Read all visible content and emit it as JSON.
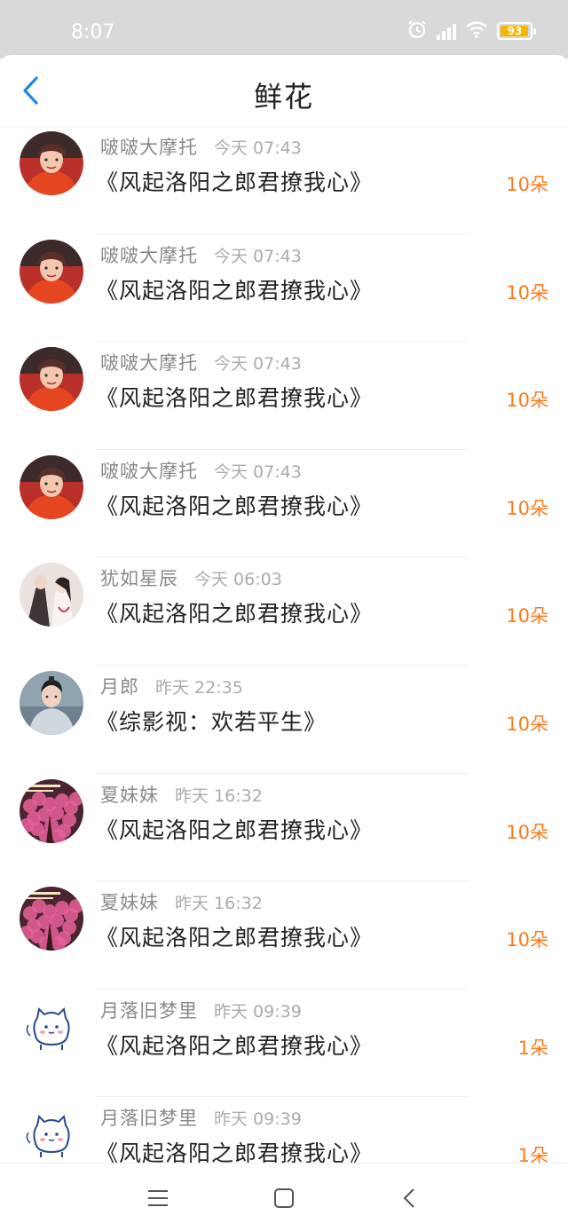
{
  "status_bar": {
    "time": "8:07",
    "battery": "93",
    "battery_color": "#f5b400"
  },
  "header": {
    "title": "鲜花",
    "accent": "#1e88e5"
  },
  "gifts": [
    {
      "avatar": "avatar-boy-orange-hoodie",
      "user": "啵啵大摩托",
      "time": "今天 07:43",
      "book": "《风起洛阳之郎君撩我心》",
      "count": "10朵"
    },
    {
      "avatar": "avatar-boy-orange-hoodie",
      "user": "啵啵大摩托",
      "time": "今天 07:43",
      "book": "《风起洛阳之郎君撩我心》",
      "count": "10朵"
    },
    {
      "avatar": "avatar-boy-orange-hoodie",
      "user": "啵啵大摩托",
      "time": "今天 07:43",
      "book": "《风起洛阳之郎君撩我心》",
      "count": "10朵"
    },
    {
      "avatar": "avatar-boy-orange-hoodie",
      "user": "啵啵大摩托",
      "time": "今天 07:43",
      "book": "《风起洛阳之郎君撩我心》",
      "count": "10朵"
    },
    {
      "avatar": "avatar-costume-couple",
      "user": "犹如星辰",
      "time": "今天 06:03",
      "book": "《风起洛阳之郎君撩我心》",
      "count": "10朵"
    },
    {
      "avatar": "avatar-costume-man",
      "user": "月郎",
      "time": "昨天 22:35",
      "book": "《综影视：欢若平生》",
      "count": "10朵"
    },
    {
      "avatar": "avatar-pink-blossoms",
      "user": "夏妹妹",
      "time": "昨天 16:32",
      "book": "《风起洛阳之郎君撩我心》",
      "count": "10朵"
    },
    {
      "avatar": "avatar-pink-blossoms",
      "user": "夏妹妹",
      "time": "昨天 16:32",
      "book": "《风起洛阳之郎君撩我心》",
      "count": "10朵"
    },
    {
      "avatar": "avatar-white-cat",
      "user": "月落旧梦里",
      "time": "昨天 09:39",
      "book": "《风起洛阳之郎君撩我心》",
      "count": "1朵"
    },
    {
      "avatar": "avatar-white-cat",
      "user": "月落旧梦里",
      "time": "昨天 09:39",
      "book": "《风起洛阳之郎君撩我心》",
      "count": "1朵"
    }
  ],
  "colors": {
    "count": "#ff7a1a",
    "name": "#8a8a8a",
    "book": "#222222"
  }
}
